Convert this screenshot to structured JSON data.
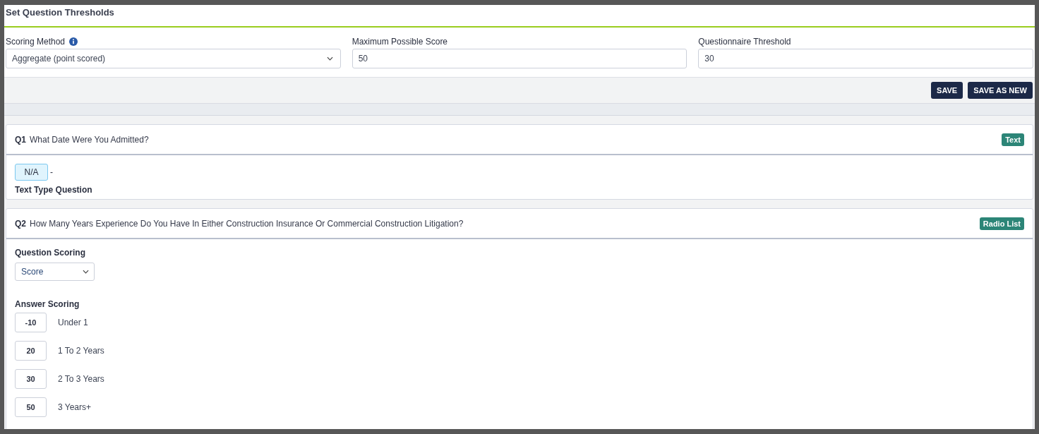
{
  "header": {
    "title": "Set Question Thresholds"
  },
  "fields": [
    {
      "kind": "select",
      "label": "Scoring Method",
      "info": true,
      "value": "Aggregate (point scored)"
    },
    {
      "kind": "input",
      "label": "Maximum Possible Score",
      "info": false,
      "value": "50"
    },
    {
      "kind": "input",
      "label": "Questionnaire Threshold",
      "info": false,
      "value": "30"
    }
  ],
  "buttons": [
    "SAVE",
    "SAVE AS NEW"
  ],
  "questions": [
    {
      "kind": "text",
      "number": "Q1",
      "text": "What Date Were You Admitted?",
      "type_badge": "Text",
      "na_value": "N/A",
      "separator": "-",
      "note": "Text Type Question"
    },
    {
      "kind": "radio_list",
      "number": "Q2",
      "text": "How Many Years Experience Do You Have In Either Construction Insurance Or Commercial Construction Litigation?",
      "type_badge": "Radio List",
      "scoring_label": "Question Scoring",
      "scoring_value": "Score",
      "answers_label": "Answer Scoring",
      "answers": [
        {
          "score": "-10",
          "label": "Under 1"
        },
        {
          "score": "20",
          "label": "1 To 2 Years"
        },
        {
          "score": "30",
          "label": "2 To 3 Years"
        },
        {
          "score": "50",
          "label": "3 Years+"
        }
      ]
    }
  ]
}
